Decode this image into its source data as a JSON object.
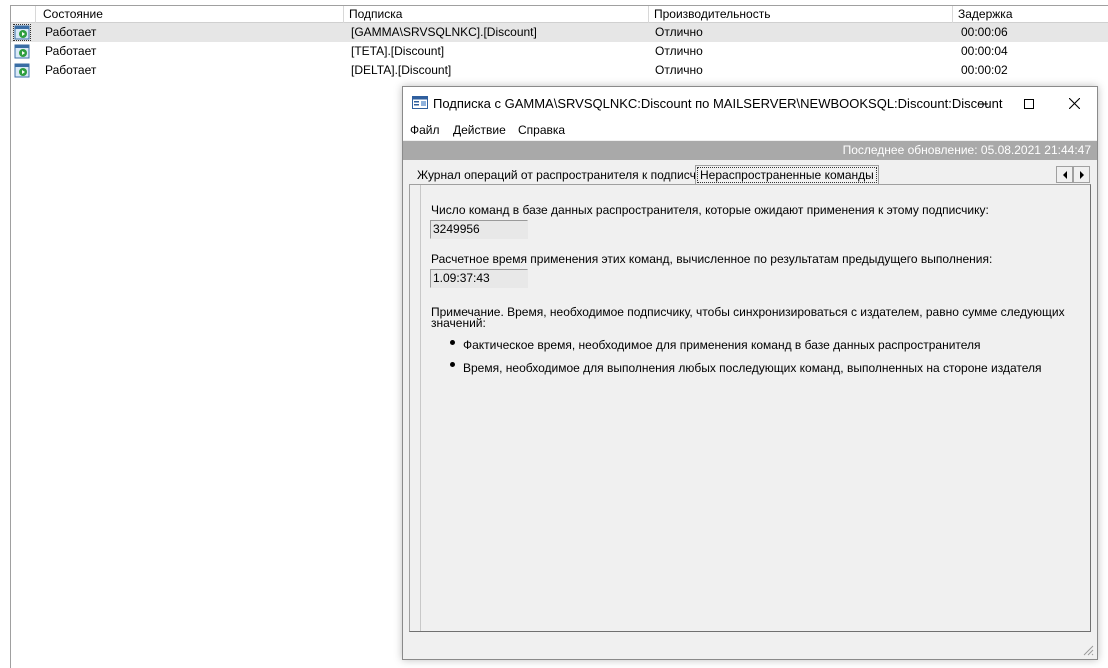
{
  "list": {
    "columns": [
      "Состояние",
      "Подписка",
      "Производительность",
      "Задержка"
    ],
    "rows": [
      {
        "status": "Работает",
        "subscription": "[GAMMA\\SRVSQLNKC].[Discount]",
        "performance": "Отлично",
        "latency": "00:00:06",
        "icon": "subscription-running-icon"
      },
      {
        "status": "Работает",
        "subscription": "[TETA].[Discount]",
        "performance": "Отлично",
        "latency": "00:00:04",
        "icon": "subscription-running-icon"
      },
      {
        "status": "Работает",
        "subscription": "[DELTA].[Discount]",
        "performance": "Отлично",
        "latency": "00:00:02",
        "icon": "subscription-running-icon"
      }
    ]
  },
  "dialog": {
    "title": "Подписка с GAMMA\\SRVSQLNKC:Discount по MAILSERVER\\NEWBOOKSQL:Discount:Discount",
    "menu": [
      "Файл",
      "Действие",
      "Справка"
    ],
    "last_update": "Последнее обновление: 05.08.2021 21:44:47",
    "tabs": [
      "Журнал операций от распространителя к подписчику",
      "Нераспространенные команды"
    ],
    "active_tab": 1,
    "panel": {
      "commands_label": "Число команд в базе данных распространителя, которые ожидают применения к этому подписчику:",
      "commands_value": "3249956",
      "time_label": "Расчетное время применения этих команд, вычисленное по результатам предыдущего выполнения:",
      "time_value": "1.09:37:43",
      "note_line1": "Примечание. Время, необходимое подписчику, чтобы синхронизироваться с издателем, равно сумме следующих",
      "note_line2": "значений:",
      "bullets": [
        "Фактическое время, необходимое для применения команд в базе данных распространителя",
        "Время, необходимое для выполнения любых последующих команд, выполненных на стороне издателя"
      ]
    }
  },
  "colors": {
    "statusbar_bg": "#a9a9a9",
    "selected_row_bg": "#e6e6e6",
    "window_bg": "#f0f0f0"
  }
}
